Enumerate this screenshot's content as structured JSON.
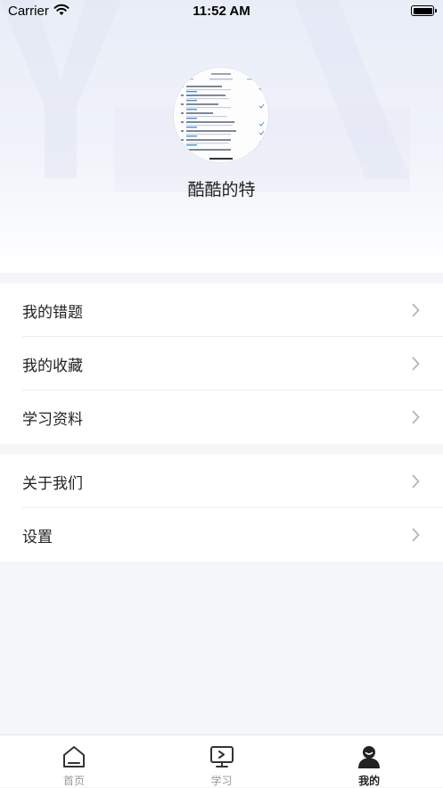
{
  "status_bar": {
    "carrier": "Carrier",
    "time": "11:52 AM"
  },
  "profile": {
    "username": "酷酷的特"
  },
  "menu": {
    "group1": [
      {
        "label": "我的错题"
      },
      {
        "label": "我的收藏"
      },
      {
        "label": "学习资料"
      }
    ],
    "group2": [
      {
        "label": "关于我们"
      },
      {
        "label": "设置"
      }
    ]
  },
  "tabbar": {
    "tabs": [
      {
        "label": "首页",
        "icon": "home-icon"
      },
      {
        "label": "学习",
        "icon": "play-screen-icon"
      },
      {
        "label": "我的",
        "icon": "user-icon",
        "active": true
      }
    ]
  },
  "colors": {
    "active": "#222222",
    "inactive": "#999999",
    "background": "#f5f6f8"
  }
}
